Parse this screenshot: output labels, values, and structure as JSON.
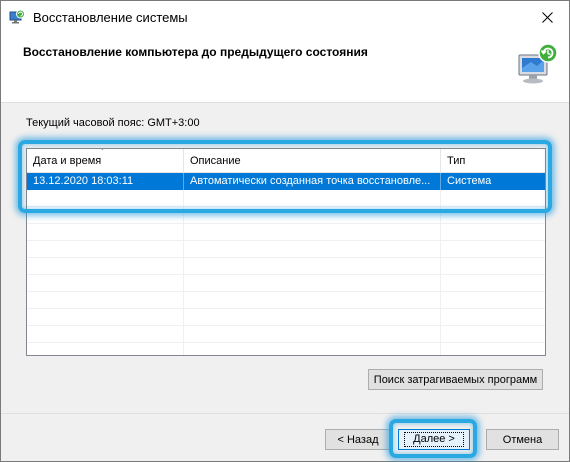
{
  "window": {
    "title": "Восстановление системы",
    "close_glyph": "✕"
  },
  "header": {
    "title": "Восстановление компьютера до предыдущего состояния",
    "graphic_icon": "system-restore-monitor-icon"
  },
  "timezone": "Текущий часовой пояс: GMT+3:00",
  "table": {
    "columns": [
      "Дата и время",
      "Описание",
      "Тип"
    ],
    "sort_indicator": "˅",
    "rows": [
      {
        "datetime": "13.12.2020 18:03:11",
        "description": "Автоматически созданная точка восстановле...",
        "type": "Система",
        "selected": true
      }
    ]
  },
  "buttons": {
    "scan": "Поиск затрагиваемых программ",
    "back": "< Назад",
    "next": "Далее >",
    "cancel": "Отмена"
  },
  "colors": {
    "selection": "#0078d7",
    "highlight": "#2aa8e2"
  }
}
